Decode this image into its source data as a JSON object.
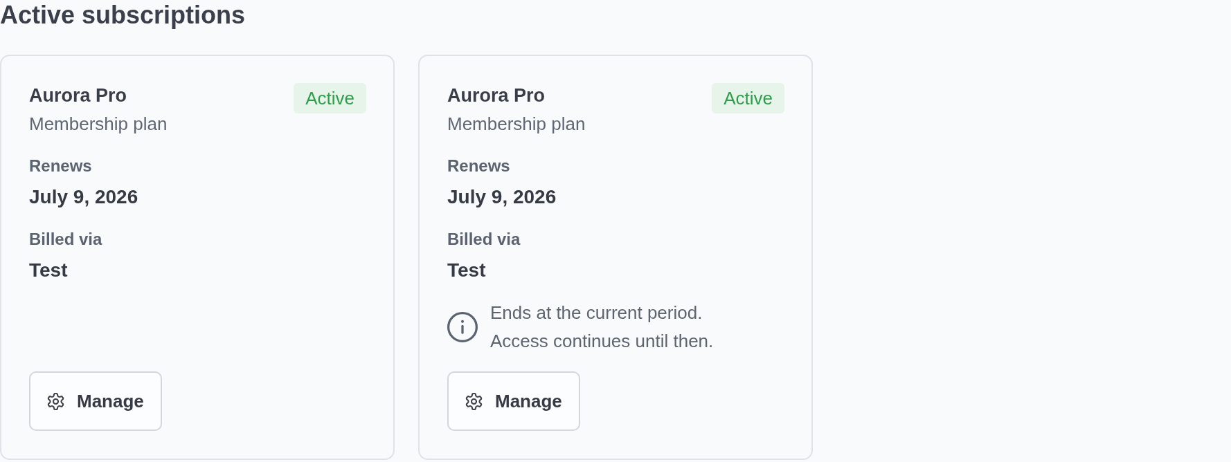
{
  "heading": "Active subscriptions",
  "subscriptions": [
    {
      "name": "Aurora Pro",
      "plan": "Membership plan",
      "status": "Active",
      "fields": [
        {
          "label": "Renews",
          "value": "July 9, 2026"
        },
        {
          "label": "Billed via",
          "value": "Test"
        }
      ],
      "button": "Manage"
    },
    {
      "name": "Aurora Pro",
      "plan": "Membership plan",
      "status": "Active",
      "fields": [
        {
          "label": "Renews",
          "value": "July 9, 2026"
        },
        {
          "label": "Billed via",
          "value": "Test"
        }
      ],
      "notice": [
        "Ends at the current period.",
        "Access continues until then."
      ],
      "button": "Manage"
    }
  ]
}
